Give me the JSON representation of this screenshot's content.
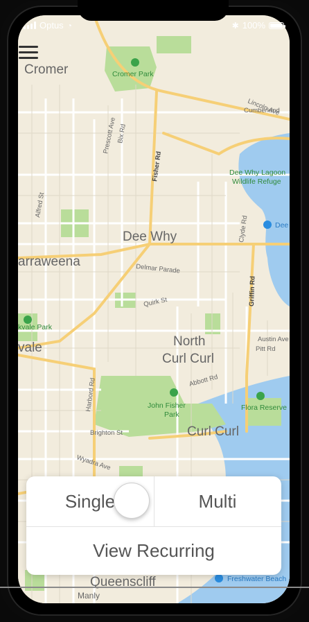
{
  "status_bar": {
    "carrier": "Optus",
    "battery": "100%"
  },
  "map": {
    "labels": {
      "cromer": "Cromer",
      "cromer_park": "Cromer Park",
      "lincoln_ave": "Lincoln Ave",
      "cumberland": "Cumberland",
      "prescott_ave": "Prescott Ave",
      "bix_rd": "Bix Rd",
      "fisher_rd": "Fisher Rd",
      "lagoon_1": "Dee Why Lagoon",
      "lagoon_2": "Wildlife Refuge",
      "alfred_st": "Alfred St",
      "dee_why": "Dee Why",
      "dee": "Dee",
      "clyde_rd": "Clyde Rd",
      "narraweena": "arraweena",
      "delmar": "Delmar Parade",
      "griffin_rd": "Griffin Rd",
      "quirk_st": "Quirk St",
      "kvale_park": "kvale Park",
      "north": "North",
      "curl_curl": "Curl Curl",
      "austin_ave": "Austin Ave",
      "pitt_rd": "Pitt Rd",
      "vale": "vale",
      "abbott_rd": "Abbott Rd",
      "harbord_rd": "Harbord Rd",
      "john_fisher_1": "John Fisher",
      "john_fisher_2": "Park",
      "flora_reserve": "Flora Reserve",
      "brighton_st": "Brighton St",
      "curl_curl_2": "Curl Curl",
      "wyadra_ave": "Wyadra Ave",
      "queenscliff": "Queenscliff",
      "freshwater_beach": "Freshwater Beach",
      "manly": "Manly"
    }
  },
  "controls": {
    "single_label": "Single",
    "multi_label": "Multi",
    "recurring_label": "View Recurring"
  },
  "colors": {
    "park": "#b9dd9a",
    "water": "#9fcbef",
    "land": "#f2ecdd",
    "road_major": "#f6cf76",
    "road_minor": "#ffffff"
  }
}
